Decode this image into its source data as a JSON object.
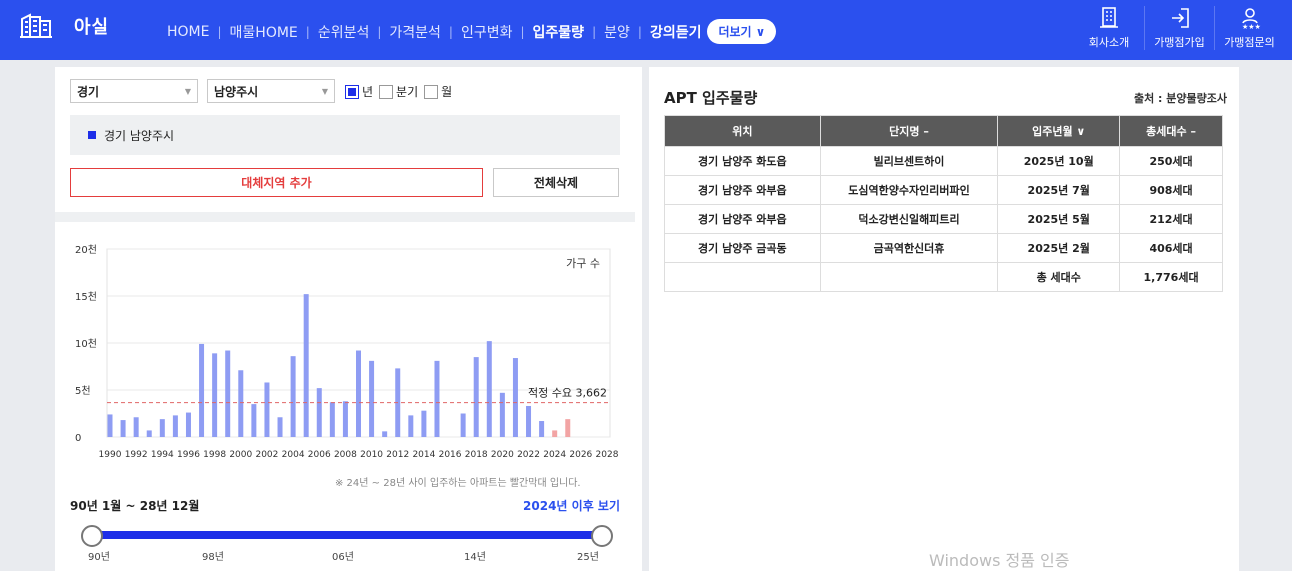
{
  "brand": {
    "name": "아실"
  },
  "nav": [
    {
      "label": "HOME",
      "bold": false
    },
    {
      "label": "매물HOME",
      "bold": false
    },
    {
      "label": "순위분석",
      "bold": false
    },
    {
      "label": "가격분석",
      "bold": false
    },
    {
      "label": "인구변화",
      "bold": false
    },
    {
      "label": "입주물량",
      "bold": true
    },
    {
      "label": "분양",
      "bold": false
    },
    {
      "label": "강의듣기",
      "bold": true
    }
  ],
  "more_button": "더보기",
  "right_menu": [
    "회사소개",
    "가맹점가입",
    "가맹점문의"
  ],
  "filters": {
    "province": "경기",
    "city": "남양주시",
    "period_options": [
      {
        "label": "년",
        "checked": true
      },
      {
        "label": "분기",
        "checked": false
      },
      {
        "label": "월",
        "checked": false
      }
    ]
  },
  "selected_region": "경기 남양주시",
  "buttons": {
    "add_region": "대체지역 추가",
    "delete_all": "전체삭제"
  },
  "chart_data": {
    "type": "bar",
    "ylabel": "가구 수",
    "y_ticks": [
      "0",
      "5천",
      "10천",
      "15천",
      "20천"
    ],
    "ylim": [
      0,
      20000
    ],
    "x_tick_labels": [
      "1990",
      "1992",
      "1994",
      "1996",
      "1998",
      "2000",
      "2002",
      "2004",
      "2006",
      "2008",
      "2010",
      "2012",
      "2014",
      "2016",
      "2018",
      "2020",
      "2022",
      "2024",
      "2026",
      "2028"
    ],
    "categories": [
      1990,
      1991,
      1992,
      1993,
      1994,
      1995,
      1996,
      1997,
      1998,
      1999,
      2000,
      2001,
      2002,
      2003,
      2004,
      2005,
      2006,
      2007,
      2008,
      2009,
      2010,
      2011,
      2012,
      2013,
      2014,
      2015,
      2016,
      2017,
      2018,
      2019,
      2020,
      2021,
      2022,
      2023,
      2024,
      2025
    ],
    "values": [
      2400,
      1800,
      2100,
      700,
      1900,
      2300,
      2600,
      9900,
      8900,
      9200,
      7100,
      3500,
      5800,
      2100,
      8600,
      15200,
      5200,
      3700,
      3800,
      9200,
      8100,
      600,
      7300,
      2300,
      2800,
      8100,
      0,
      2500,
      8500,
      10200,
      4700,
      8400,
      3300,
      1700,
      700,
      1900
    ],
    "highlight_from": 2024,
    "colors": {
      "normal": "#8e9cf3",
      "highlight": "#f2a4a4"
    },
    "reference_line": {
      "label": "적정 수요 3,662",
      "value": 3662,
      "color": "#e06666"
    },
    "grid": true
  },
  "chart_note": "※ 24년 ~ 28년 사이 입주하는 아파트는 빨간막대 입니다.",
  "range": {
    "title": "90년 1월 ~ 28년 12월",
    "link": "2024년 이후 보기",
    "ticks": [
      "90년",
      "98년",
      "06년",
      "14년",
      "25년"
    ]
  },
  "apt": {
    "title": "APT 입주물량",
    "source": "출처 : 분양물량조사",
    "headers": [
      "위치",
      "단지명 –",
      "입주년월 ∨",
      "총세대수 –"
    ],
    "rows": [
      [
        "경기 남양주 화도읍",
        "빌리브센트하이",
        "2025년 10월",
        "250세대"
      ],
      [
        "경기 남양주 와부읍",
        "도심역한양수자인리버파인",
        "2025년 7월",
        "908세대"
      ],
      [
        "경기 남양주 와부읍",
        "덕소강변신일해피트리",
        "2025년 5월",
        "212세대"
      ],
      [
        "경기 남양주 금곡동",
        "금곡역한신더휴",
        "2025년 2월",
        "406세대"
      ]
    ],
    "total_label": "총 세대수",
    "total_value": "1,776세대"
  },
  "watermark": "Windows 정품 인증"
}
